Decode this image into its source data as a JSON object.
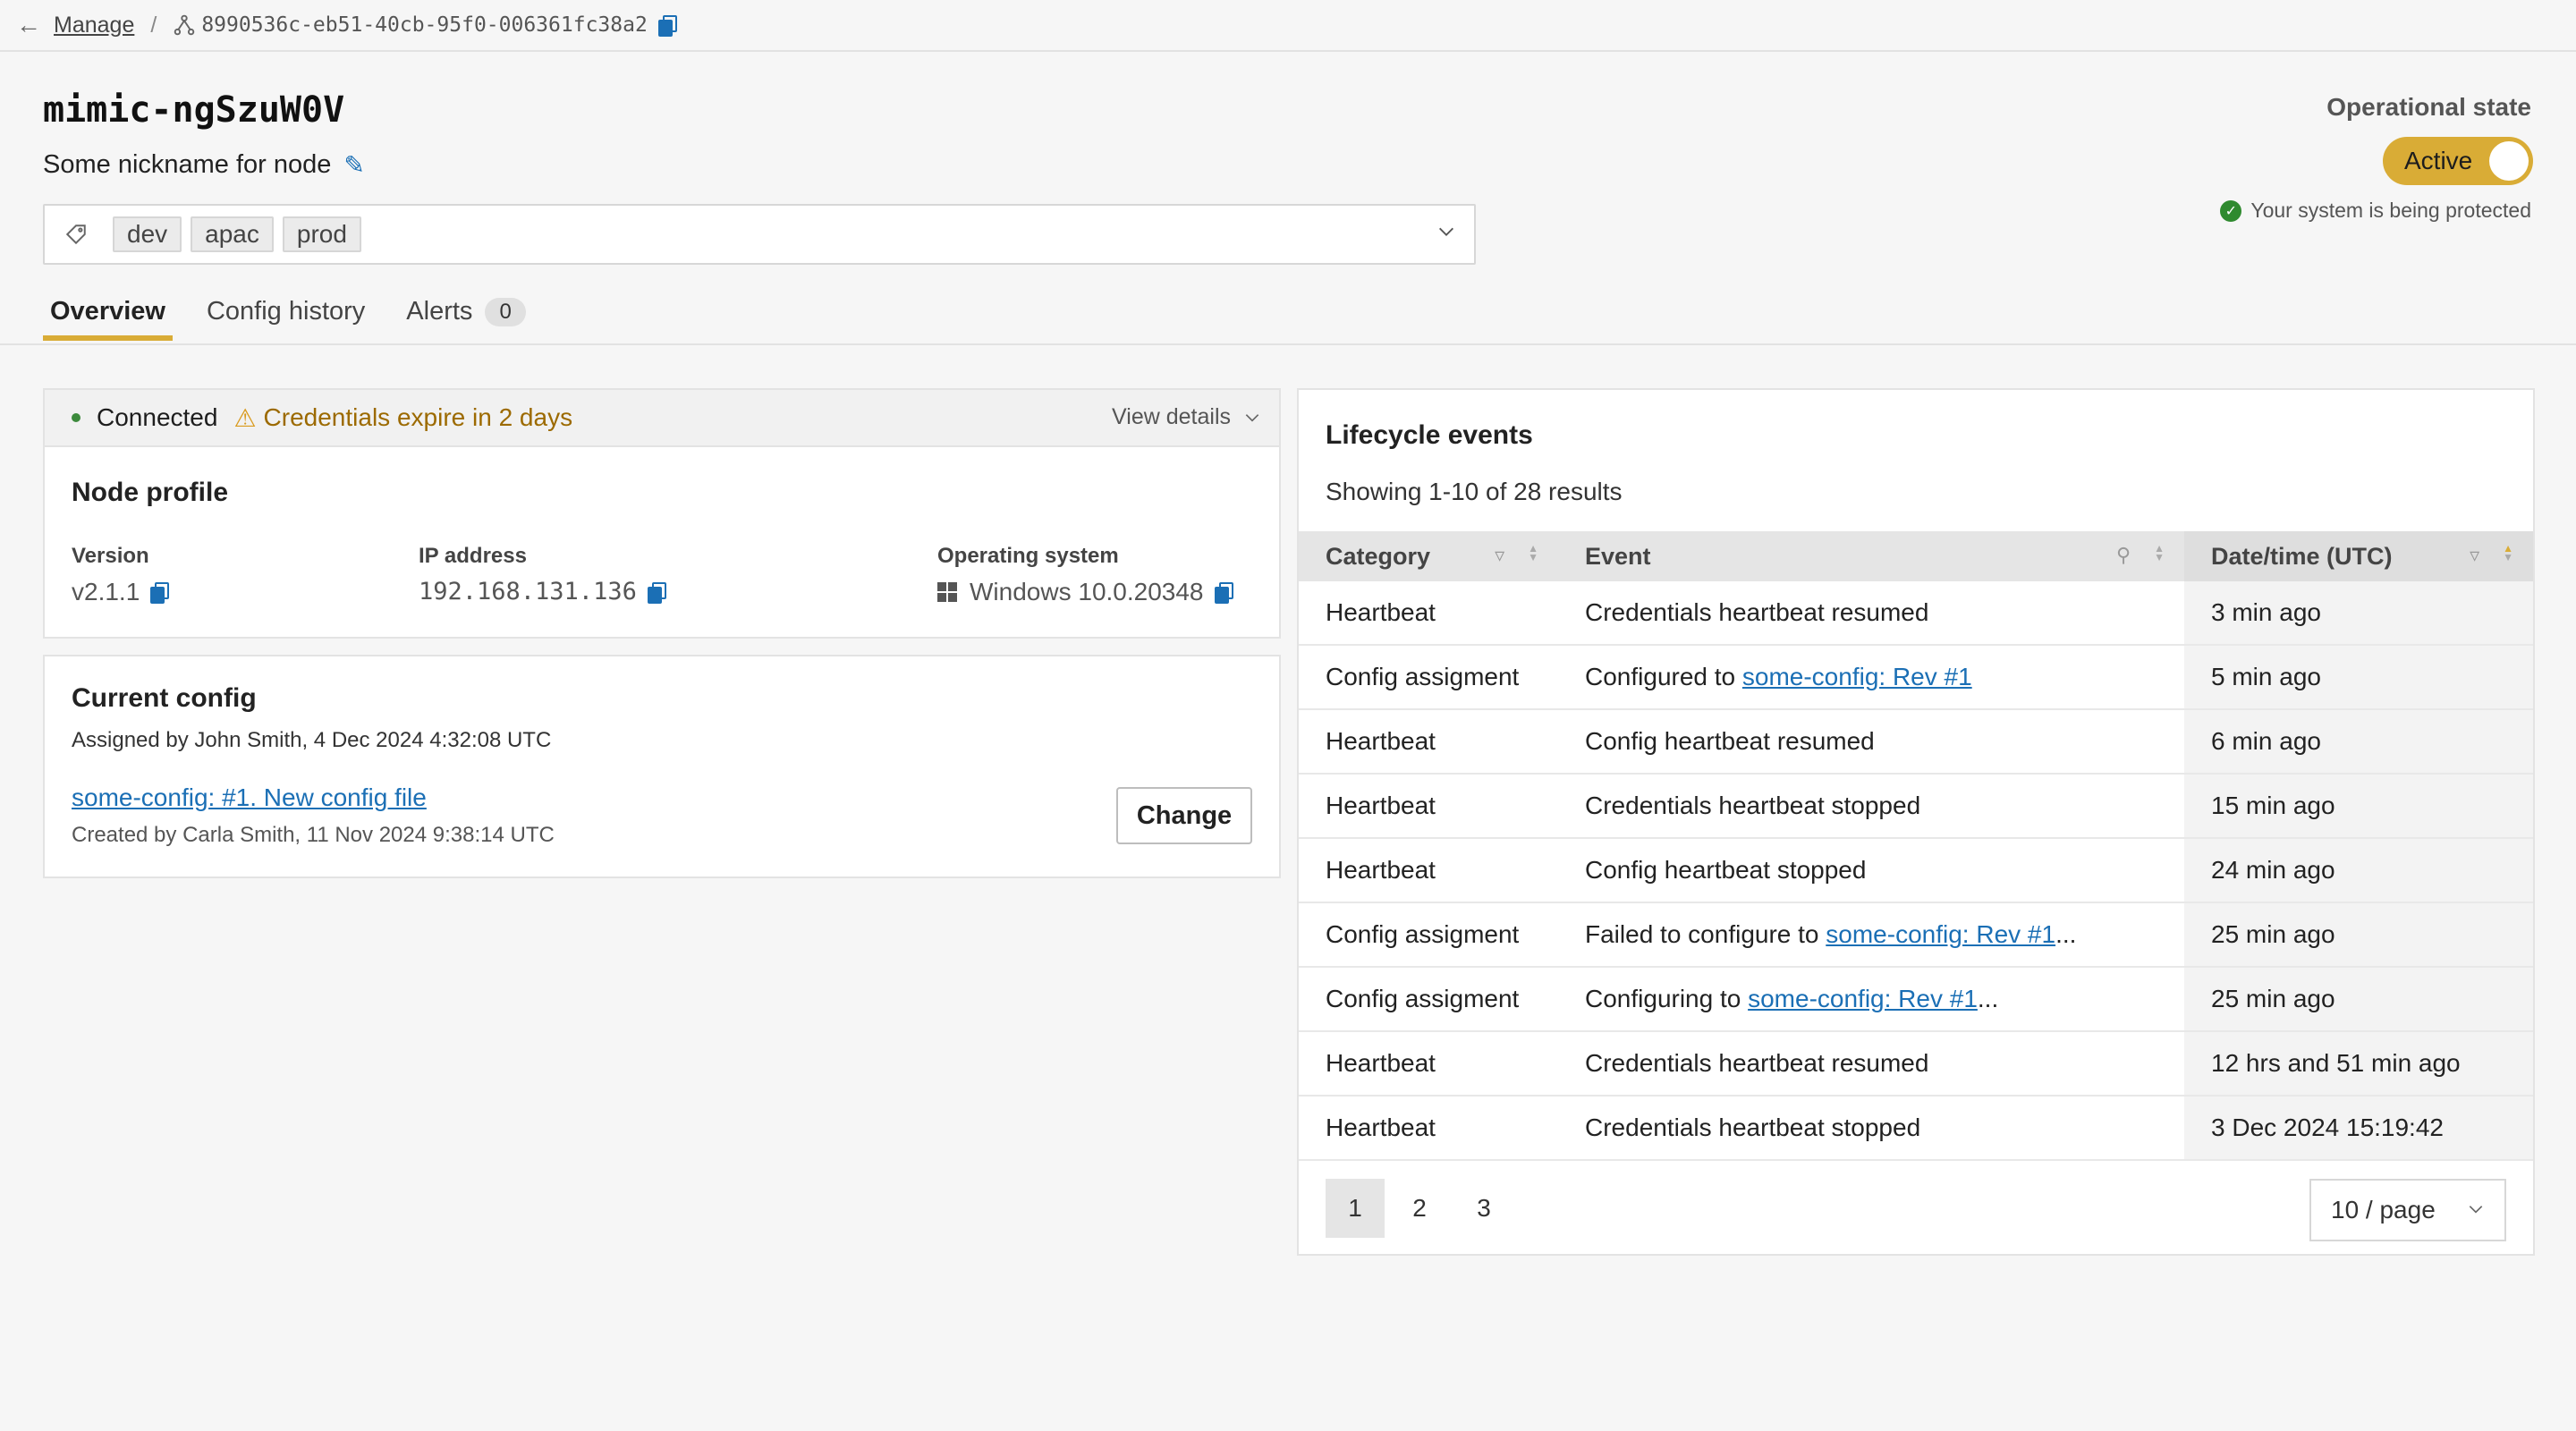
{
  "breadcrumb": {
    "back_icon": "arrow-left-icon",
    "manage": "Manage",
    "separator": "/",
    "node_id": "8990536c-eb51-40cb-95f0-006361fc38a2"
  },
  "header": {
    "title": "mimic-ngSzuW0V",
    "nickname": "Some nickname for node",
    "tags": [
      "dev",
      "apac",
      "prod"
    ]
  },
  "operational": {
    "label": "Operational state",
    "toggle": "Active",
    "protection": "Your system is being protected"
  },
  "tabs": {
    "overview": "Overview",
    "config_history": "Config history",
    "alerts": "Alerts",
    "alerts_count": "0"
  },
  "status": {
    "connected": "Connected",
    "warning": "Credentials expire in 2 days",
    "view_details": "View details"
  },
  "profile": {
    "title": "Node profile",
    "version_label": "Version",
    "version": "v2.1.1",
    "ip_label": "IP address",
    "ip": "192.168.131.136",
    "os_label": "Operating system",
    "os": "Windows 10.0.20348"
  },
  "config": {
    "title": "Current config",
    "assigned": "Assigned by John Smith, 4 Dec 2024 4:32:08 UTC",
    "link": "some-config: #1. New config file",
    "created": "Created by Carla Smith, 11 Nov 2024 9:38:14 UTC",
    "change": "Change"
  },
  "events": {
    "title": "Lifecycle events",
    "count": "Showing 1-10 of 28 results",
    "columns": [
      "Category",
      "Event",
      "Date/time (UTC)"
    ],
    "rows": [
      {
        "category": "Heartbeat",
        "event": "Credentials heartbeat resumed",
        "link": "",
        "suffix": "",
        "time": "3 min ago"
      },
      {
        "category": "Config assigment",
        "event": "Configured to ",
        "link": "some-config: Rev #1",
        "suffix": "",
        "time": "5 min ago"
      },
      {
        "category": "Heartbeat",
        "event": "Config heartbeat resumed",
        "link": "",
        "suffix": "",
        "time": "6 min ago"
      },
      {
        "category": "Heartbeat",
        "event": "Credentials heartbeat stopped",
        "link": "",
        "suffix": "",
        "time": "15 min ago"
      },
      {
        "category": "Heartbeat",
        "event": "Config heartbeat stopped",
        "link": "",
        "suffix": "",
        "time": "24 min ago"
      },
      {
        "category": "Config assigment",
        "event": "Failed to configure to ",
        "link": "some-config: Rev #1",
        "suffix": "...",
        "time": "25 min ago"
      },
      {
        "category": "Config assigment",
        "event": "Configuring to ",
        "link": "some-config: Rev #1",
        "suffix": "...",
        "time": "25 min ago"
      },
      {
        "category": "Heartbeat",
        "event": "Credentials heartbeat resumed",
        "link": "",
        "suffix": "",
        "time": "12 hrs and 51 min ago"
      },
      {
        "category": "Heartbeat",
        "event": "Credentials heartbeat stopped",
        "link": "",
        "suffix": "",
        "time": "3 Dec 2024 15:19:42"
      }
    ],
    "pages": [
      "1",
      "2",
      "3"
    ],
    "per_page": "10 / page"
  }
}
